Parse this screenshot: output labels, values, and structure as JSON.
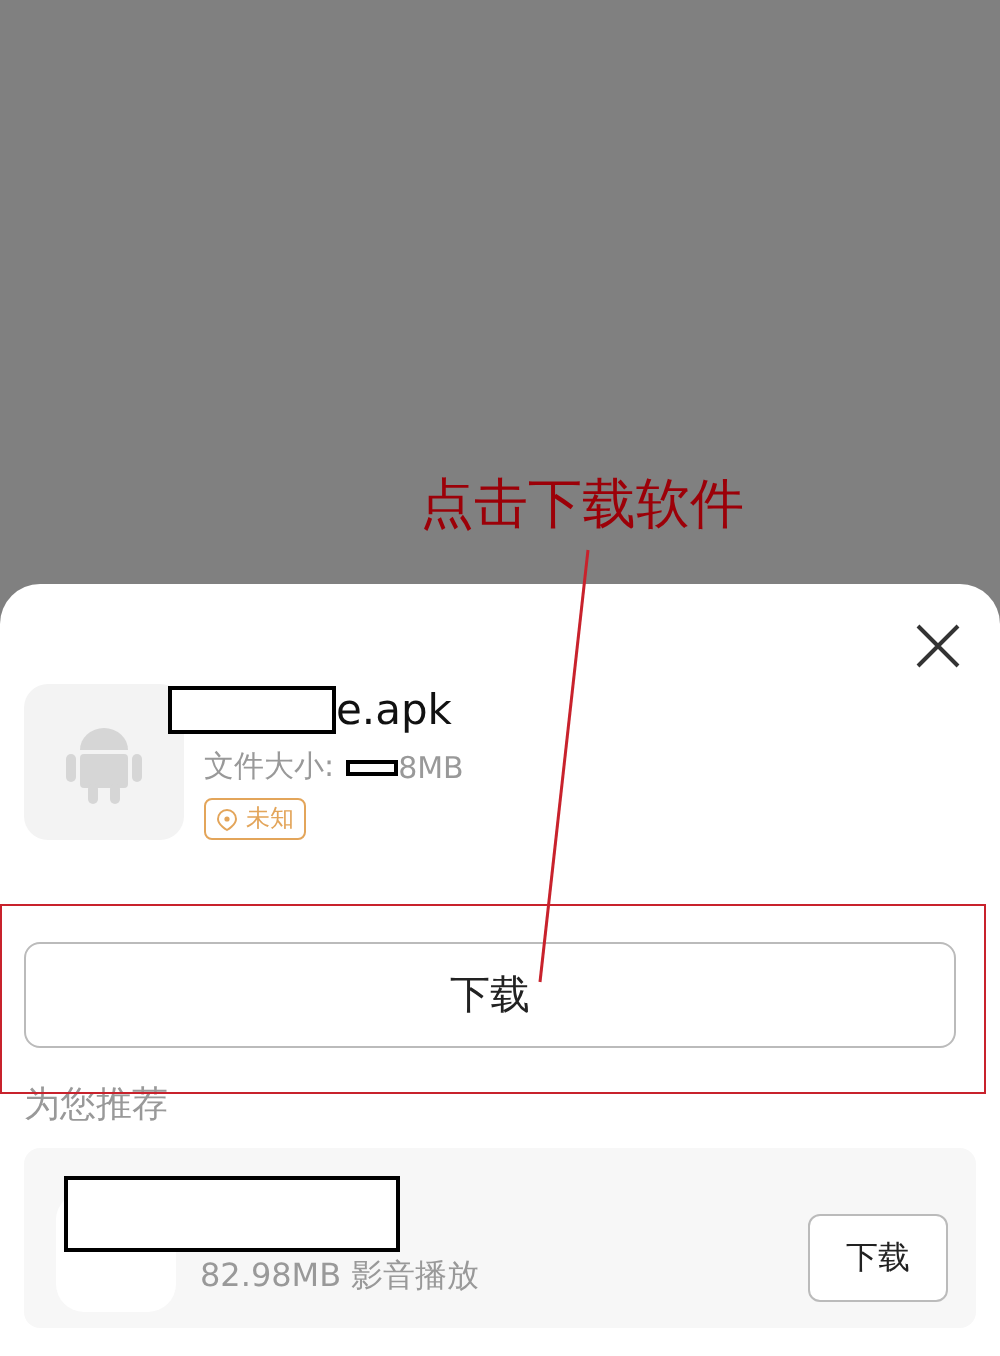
{
  "annotation": {
    "text": "点击下载软件"
  },
  "dialog": {
    "file_name": "e.apk",
    "size_label": "文件大小:",
    "size_value": "8MB",
    "badge": "未知",
    "download_button": "下载"
  },
  "recommend": {
    "heading": "为您推荐",
    "apps": [
      {
        "details": "82.98MB 影音播放",
        "button": "下载"
      }
    ]
  }
}
